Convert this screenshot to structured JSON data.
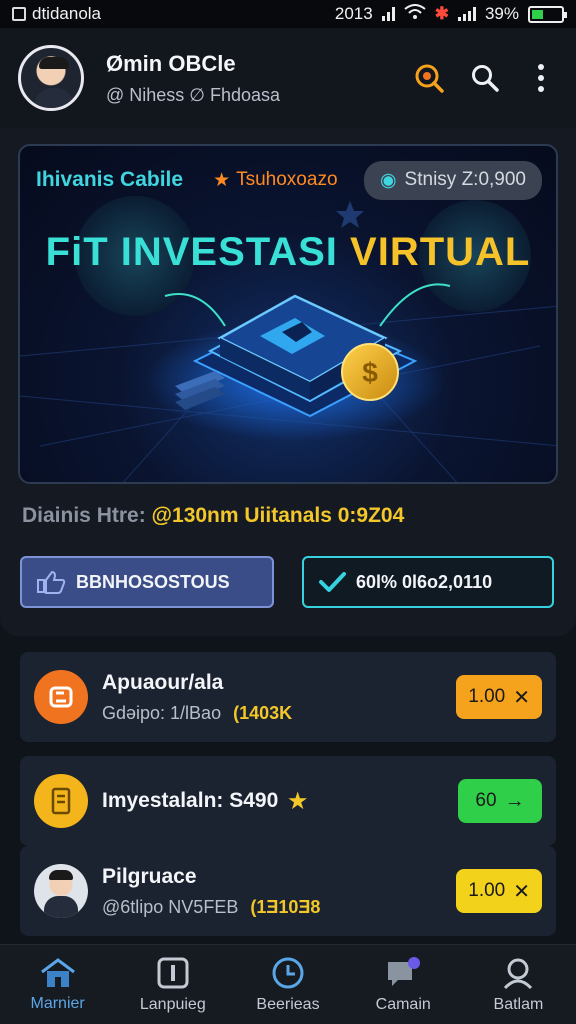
{
  "status_bar": {
    "app_label": "dtidanola",
    "time": "2013",
    "battery": "39%",
    "battery_level": 0.39
  },
  "header": {
    "user_name": "Ømin OBCle",
    "user_sub": "@ Nihess ∅ Fhdoasa",
    "icons": [
      "orange-search-icon",
      "search-icon",
      "more-vert-icon"
    ]
  },
  "banner": {
    "tag": "Ihivanis Cabile",
    "rating": "Tsuhoxoazo",
    "stats": "Stnisy Z:0,900",
    "title_main": "FiT INVESTASI ",
    "title_accent": "VIRTUAL"
  },
  "stats_line": {
    "label": "Diainis Htre:",
    "value": "@130nm Uiitanals 0:9Z04"
  },
  "buttons": {
    "primary_label": "BBNHOSOSTOUS",
    "secondary_label": "60l% 0l6o2,0110"
  },
  "list": [
    {
      "title": "Apuaour/ala",
      "sub": "Gdəipo: 1/lBao",
      "amount": "(1403K",
      "pill": "1.00",
      "pill_icon": "close-icon",
      "icon_color": "#f0731f",
      "pill_color": "#f5a21c"
    },
    {
      "title": "Imyestalaln: S490",
      "pill": "60",
      "pill_icon": "arrow-right-icon",
      "icon_color": "#f3b51b",
      "pill_color": "#2fcf4a"
    },
    {
      "title": "Pilgruace",
      "sub": "@6tlipo NV5FEB",
      "amount": "(1Ǝ10Ǝ8",
      "pill": "1.00",
      "pill_icon": "close-icon",
      "pill_color": "#f3d21c"
    }
  ],
  "nav": [
    {
      "label": "Marnier",
      "icon": "home-icon"
    },
    {
      "label": "Lanpuieg",
      "icon": "info-icon"
    },
    {
      "label": "Beerieas",
      "icon": "clock-icon"
    },
    {
      "label": "Camain",
      "icon": "chat-icon"
    },
    {
      "label": "Batlam",
      "icon": "profile-icon"
    }
  ]
}
